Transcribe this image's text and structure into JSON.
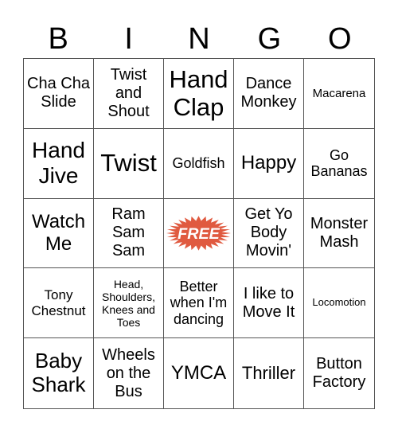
{
  "header": [
    "B",
    "I",
    "N",
    "G",
    "O"
  ],
  "free_label": "FREE",
  "free_color": "#e05a40",
  "cells": [
    "Cha Cha Slide",
    "Twist and Shout",
    "Hand Clap",
    "Dance Monkey",
    "Macarena",
    "Hand Jive",
    "Twist",
    "Goldfish",
    "Happy",
    "Go Bananas",
    "Watch Me",
    "Ram Sam Sam",
    "FREE",
    "Get Yo Body Movin'",
    "Monster Mash",
    "Tony Chestnut",
    "Head, Shoulders, Knees and Toes",
    "Better when I'm dancing",
    "I like to Move It",
    "Locomotion",
    "Baby Shark",
    "Wheels on the Bus",
    "YMCA",
    "Thriller",
    "Button Factory"
  ]
}
